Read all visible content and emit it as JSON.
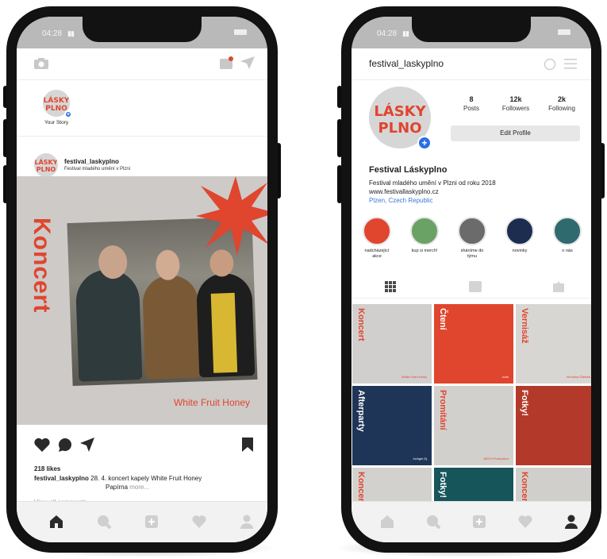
{
  "left_phone": {
    "status_time": "04:28",
    "story": {
      "label": "Your Story"
    },
    "post": {
      "username": "festival_laskyplno",
      "subtitle": "Festival mladého umění v Plzni",
      "image_title": "Koncert",
      "band_name": "White Fruit Honey",
      "likes": "218 likes",
      "caption_user": "festival_laskyplno",
      "caption_text": "28. 4. koncert kapely White Fruit Honey",
      "caption_line2": "Papírna",
      "more_label": "more...",
      "view_comments": "View all comments"
    }
  },
  "right_phone": {
    "status_time": "04:28",
    "username": "festival_laskyplno",
    "stats": {
      "posts": {
        "value": "8",
        "label": "Posts"
      },
      "followers": {
        "value": "12k",
        "label": "Followers"
      },
      "following": {
        "value": "2k",
        "label": "Following"
      }
    },
    "edit_label": "Edit Profile",
    "profile_name": "Festival Láskyplno",
    "bio_line1": "Festival mladého umění v Plzni od roku 2018",
    "website": "www.festivallaskyplno.cz",
    "location": "Plzen, Czech Republic",
    "highlights": [
      {
        "label": "nadcházející akce",
        "color": "#e0452e"
      },
      {
        "label": "kup si merch!",
        "color": "#6aa265"
      },
      {
        "label": "sháníme do týmu",
        "color": "#6b6b6b"
      },
      {
        "label": "novinky",
        "color": "#1d2d50"
      },
      {
        "label": "o nás",
        "color": "#2f6a6e"
      }
    ],
    "grid": [
      {
        "label": "Koncert",
        "foot": "White Fruit Honey",
        "bg": "#d1cfcd",
        "fg": "#e0452e"
      },
      {
        "label": "Čtení",
        "foot": "Jonk",
        "bg": "#e0452e",
        "fg": "#ffffff"
      },
      {
        "label": "Vernisáž",
        "foot": "Veronika Židlická",
        "bg": "#d8d6d3",
        "fg": "#e0452e"
      },
      {
        "label": "Afterparty",
        "foot": "Jorkgin Dj",
        "bg": "#1e3557",
        "fg": "#ffffff"
      },
      {
        "label": "Promítání",
        "foot": "ARCH Production",
        "bg": "#d2d0cd",
        "fg": "#e0452e"
      },
      {
        "label": "Fotky!",
        "foot": "",
        "bg": "#b33a2a",
        "fg": "#ffffff"
      },
      {
        "label": "Koncert",
        "foot": "",
        "bg": "#d3d1ce",
        "fg": "#e0452e"
      },
      {
        "label": "Fotky!",
        "foot": "",
        "bg": "#16555a",
        "fg": "#ffffff"
      },
      {
        "label": "Koncert",
        "foot": "",
        "bg": "#d1cfcc",
        "fg": "#e0452e"
      }
    ]
  },
  "colors": {
    "accent": "#e0452e",
    "link": "#3a7bd5",
    "plus": "#2b6fe0"
  }
}
